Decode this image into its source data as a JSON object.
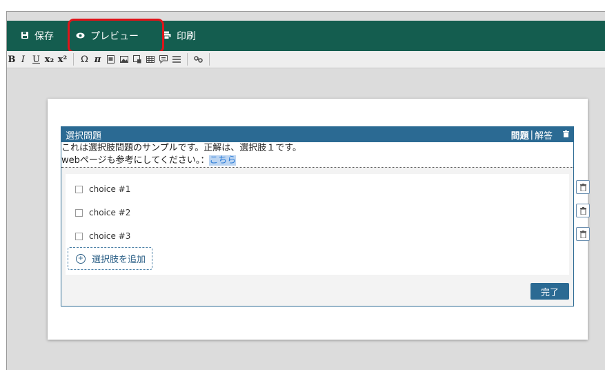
{
  "topbar": {
    "save_label": "保存",
    "preview_label": "プレビュー",
    "print_label": "印刷",
    "color": "#145d4f",
    "highlight_color": "#e0141a"
  },
  "toolbar": {
    "bold": "B",
    "italic": "I",
    "underline": "U",
    "subscript": "x₂",
    "superscript": "x²",
    "omega": "Ω",
    "pi": "π",
    "tools": [
      "special-char-icon",
      "pi-icon",
      "image-gallery-icon",
      "image-icon",
      "media-icon",
      "table-icon",
      "comment-icon",
      "horizontal-rule-icon",
      "link-icon"
    ]
  },
  "question": {
    "type_title": "選択問題",
    "tab_question": "問題",
    "tab_separator": "|",
    "tab_answer": "解答",
    "text_line1": "これは選択肢問題のサンプルです。正解は、選択肢１です。",
    "text_line2_prefix": "webページも参考にしてください。：",
    "link_text": "こちら",
    "choices": [
      "choice #1",
      "choice #2",
      "choice #3"
    ],
    "add_choice_label": "選択肢を追加",
    "done_label": "完了",
    "accent_color": "#2b6a93"
  }
}
